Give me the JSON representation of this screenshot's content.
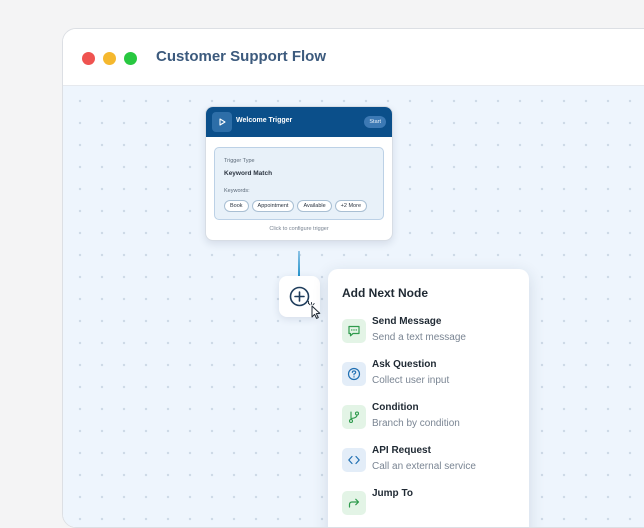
{
  "window": {
    "title": "Customer Support Flow"
  },
  "trigger_node": {
    "title": "Welcome Trigger",
    "badge": "Start",
    "type_label": "Trigger Type",
    "type_value": "Keyword Match",
    "keywords_label": "Keywords:",
    "keywords": [
      "Book",
      "Appointment",
      "Available",
      "+2 More"
    ],
    "footer": "Click to configure trigger"
  },
  "menu": {
    "title": "Add Next Node",
    "items": [
      {
        "label": "Send Message",
        "description": "Send a text message",
        "icon": "message-icon",
        "color": "green"
      },
      {
        "label": "Ask Question",
        "description": "Collect user input",
        "icon": "question-icon",
        "color": "blue"
      },
      {
        "label": "Condition",
        "description": "Branch by condition",
        "icon": "branch-icon",
        "color": "green"
      },
      {
        "label": "API Request",
        "description": "Call an external service",
        "icon": "code-icon",
        "color": "blue"
      },
      {
        "label": "Jump To",
        "description": "",
        "icon": "jump-arrow-icon",
        "color": "green"
      }
    ]
  },
  "colors": {
    "node_header": "#0b4f8a",
    "canvas": "#eef5fd",
    "accent_green": "#2e9a4c",
    "accent_blue": "#1f6fb2",
    "traffic_red": "#ef5350",
    "traffic_yellow": "#f5b82e",
    "traffic_green": "#28c840"
  }
}
